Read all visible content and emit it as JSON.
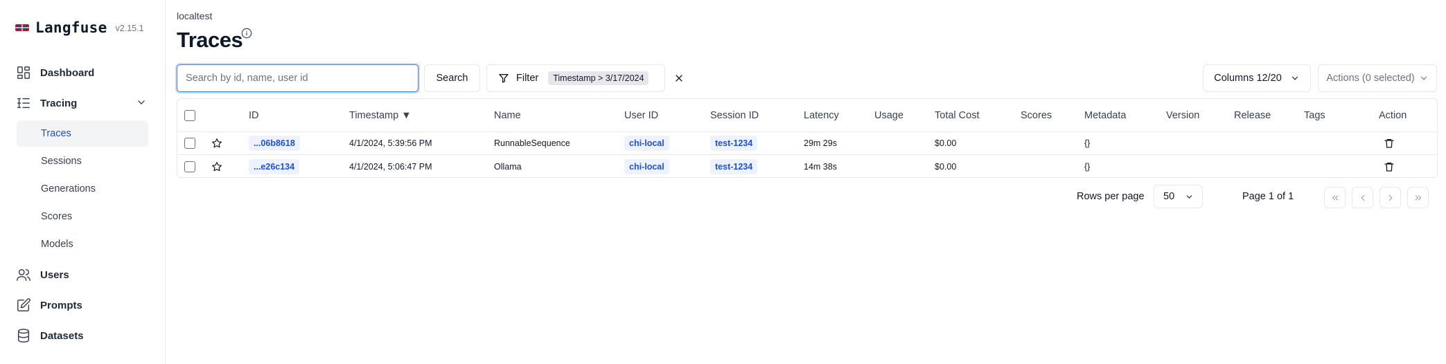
{
  "app": {
    "name": "Langfuse",
    "version": "v2.15.1"
  },
  "sidebar": {
    "items": [
      {
        "label": "Dashboard",
        "icon": "dashboard-icon"
      },
      {
        "label": "Tracing",
        "icon": "tracing-icon"
      },
      {
        "label": "Users",
        "icon": "users-icon"
      },
      {
        "label": "Prompts",
        "icon": "prompts-icon"
      },
      {
        "label": "Datasets",
        "icon": "datasets-icon"
      }
    ],
    "tracing_sub": [
      {
        "label": "Traces",
        "active": true
      },
      {
        "label": "Sessions"
      },
      {
        "label": "Generations"
      },
      {
        "label": "Scores"
      },
      {
        "label": "Models"
      }
    ]
  },
  "header": {
    "breadcrumb": "localtest",
    "title": "Traces"
  },
  "toolbar": {
    "search_placeholder": "Search by id, name, user id",
    "search_label": "Search",
    "filter_label": "Filter",
    "filter_chip": "Timestamp > 3/17/2024",
    "columns_label": "Columns 12/20",
    "actions_label": "Actions (0 selected)"
  },
  "table": {
    "columns": [
      "ID",
      "Timestamp ▼",
      "Name",
      "User ID",
      "Session ID",
      "Latency",
      "Usage",
      "Total Cost",
      "Scores",
      "Metadata",
      "Version",
      "Release",
      "Tags",
      "Action"
    ],
    "rows": [
      {
        "id": "...06b8618",
        "timestamp": "4/1/2024, 5:39:56 PM",
        "name": "RunnableSequence",
        "user_id": "chi-local",
        "session_id": "test-1234",
        "latency": "29m 29s",
        "usage": "",
        "total_cost": "$0.00",
        "scores": "",
        "metadata": "{}",
        "version": "",
        "release": "",
        "tags": ""
      },
      {
        "id": "...e26c134",
        "timestamp": "4/1/2024, 5:06:47 PM",
        "name": "Ollama",
        "user_id": "chi-local",
        "session_id": "test-1234",
        "latency": "14m 38s",
        "usage": "",
        "total_cost": "$0.00",
        "scores": "",
        "metadata": "{}",
        "version": "",
        "release": "",
        "tags": ""
      }
    ]
  },
  "pagination": {
    "rows_per_page_label": "Rows per page",
    "rows_per_page": "50",
    "page_info": "Page 1 of 1"
  },
  "colors": {
    "accent": "#1d4ed8",
    "pill_bg": "#eef2ff",
    "border": "#e5e7eb",
    "active_bg": "#f3f4f6"
  }
}
